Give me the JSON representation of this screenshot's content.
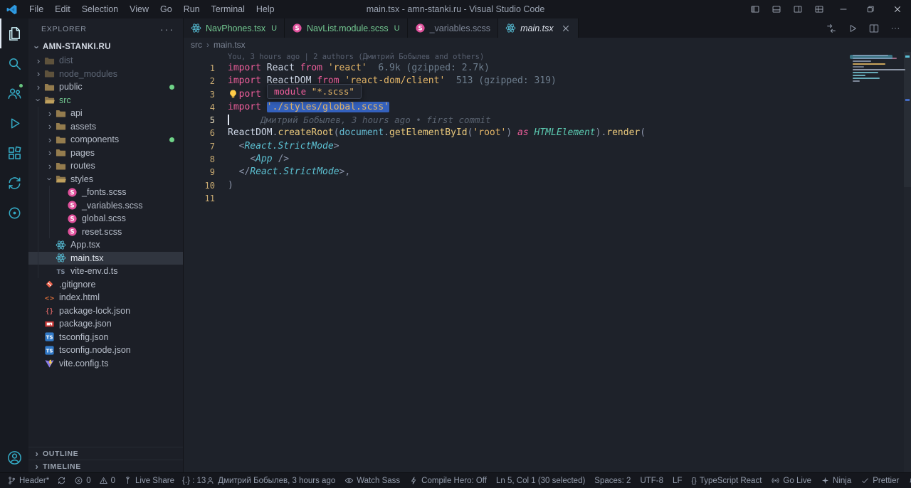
{
  "colors": {
    "accent_selection": "#3461bd",
    "untracked_green": "#73c991",
    "keyword_pink": "#ef5e9b",
    "string_gold": "#e6b768",
    "activity_teal": "#37b7d3"
  },
  "title_bar": {
    "menus": [
      "File",
      "Edit",
      "Selection",
      "View",
      "Go",
      "Run",
      "Terminal",
      "Help"
    ],
    "title": "main.tsx - amn-stanki.ru - Visual Studio Code",
    "window_controls": [
      {
        "name": "toggle-primary-sidebar",
        "icon": "panelL"
      },
      {
        "name": "toggle-panel",
        "icon": "panelB"
      },
      {
        "name": "toggle-secondary-sidebar",
        "icon": "panelR"
      },
      {
        "name": "customize-layout",
        "icon": "layoutC"
      },
      {
        "name": "minimize",
        "icon": "minim"
      },
      {
        "name": "restore",
        "icon": "restore"
      },
      {
        "name": "close",
        "icon": "closex"
      }
    ]
  },
  "activity_bar": {
    "top": [
      {
        "name": "explorer",
        "icon": "files",
        "active": true
      },
      {
        "name": "search",
        "icon": "search"
      },
      {
        "name": "accounts",
        "icon": "people",
        "badge": true
      },
      {
        "name": "run-debug",
        "icon": "run"
      },
      {
        "name": "extensions",
        "icon": "ext"
      },
      {
        "name": "remote-sync",
        "icon": "sync2"
      },
      {
        "name": "live-share",
        "icon": "circle"
      }
    ],
    "bottom": [
      {
        "name": "account",
        "icon": "account"
      }
    ]
  },
  "explorer": {
    "header": "EXPLORER",
    "root": "AMN-STANKI.RU",
    "sections": [
      "OUTLINE",
      "TIMELINE"
    ],
    "items": [
      {
        "label": "dist",
        "depth": 1,
        "icon": "folder",
        "chevron": "right",
        "dim": true
      },
      {
        "label": "node_modules",
        "depth": 1,
        "icon": "folder",
        "chevron": "right",
        "dim": true
      },
      {
        "label": "public",
        "depth": 1,
        "icon": "folder",
        "chevron": "right",
        "dot": true
      },
      {
        "label": "src",
        "depth": 1,
        "icon": "folderOpen",
        "chevron": "down",
        "git": "untracked"
      },
      {
        "label": "api",
        "depth": 2,
        "icon": "folder",
        "chevron": "right"
      },
      {
        "label": "assets",
        "depth": 2,
        "icon": "folder",
        "chevron": "right"
      },
      {
        "label": "components",
        "depth": 2,
        "icon": "folder",
        "chevron": "right",
        "dot": true
      },
      {
        "label": "pages",
        "depth": 2,
        "icon": "folder",
        "chevron": "right"
      },
      {
        "label": "routes",
        "depth": 2,
        "icon": "folder",
        "chevron": "right"
      },
      {
        "label": "styles",
        "depth": 2,
        "icon": "folderOpen",
        "chevron": "down"
      },
      {
        "label": "_fonts.scss",
        "depth": 3,
        "icon": "sass"
      },
      {
        "label": "_variables.scss",
        "depth": 3,
        "icon": "sass"
      },
      {
        "label": "global.scss",
        "depth": 3,
        "icon": "sass"
      },
      {
        "label": "reset.scss",
        "depth": 3,
        "icon": "sass"
      },
      {
        "label": "App.tsx",
        "depth": 2,
        "icon": "react"
      },
      {
        "label": "main.tsx",
        "depth": 2,
        "icon": "react",
        "selected": true
      },
      {
        "label": "vite-env.d.ts",
        "depth": 2,
        "icon": "tsfile"
      },
      {
        "label": ".gitignore",
        "depth": 1,
        "icon": "git"
      },
      {
        "label": "index.html",
        "depth": 1,
        "icon": "html"
      },
      {
        "label": "package-lock.json",
        "depth": 1,
        "icon": "jsonlock"
      },
      {
        "label": "package.json",
        "depth": 1,
        "icon": "npm"
      },
      {
        "label": "tsconfig.json",
        "depth": 1,
        "icon": "tsconfig"
      },
      {
        "label": "tsconfig.node.json",
        "depth": 1,
        "icon": "tsconfig"
      },
      {
        "label": "vite.config.ts",
        "depth": 1,
        "icon": "vite"
      }
    ]
  },
  "tabs": [
    {
      "label": "NavPhones.tsx",
      "icon": "react",
      "badge": "U",
      "git": "untracked"
    },
    {
      "label": "NavList.module.scss",
      "icon": "sass",
      "badge": "U",
      "git": "untracked"
    },
    {
      "label": "_variables.scss",
      "icon": "sass"
    },
    {
      "label": "main.tsx",
      "icon": "react",
      "active": true,
      "close": true
    }
  ],
  "editor_actions": [
    {
      "name": "open-changes",
      "icon": "compare"
    },
    {
      "name": "run-file",
      "icon": "play"
    },
    {
      "name": "split-editor",
      "icon": "split"
    },
    {
      "name": "more-actions",
      "icon": "more"
    }
  ],
  "breadcrumb": [
    "src",
    "main.tsx"
  ],
  "editor": {
    "codelens": "You, 3 hours ago | 2 authors (Дмитрий Бобылев and others)",
    "blame": "Дмитрий Бобылев, 3 hours ago • first commit",
    "tooltip": {
      "kw": "module ",
      "str": "\"*.scss\""
    },
    "lines": [
      [
        {
          "t": "import ",
          "c": "kw"
        },
        {
          "t": "React",
          "c": "var"
        },
        {
          "t": " from ",
          "c": "kw"
        },
        {
          "t": "'react'",
          "c": "str"
        },
        {
          "t": "  6.9k (gzipped: 2.7k)",
          "c": "cost"
        }
      ],
      [
        {
          "t": "import ",
          "c": "kw"
        },
        {
          "t": "ReactDOM",
          "c": "var"
        },
        {
          "t": " from ",
          "c": "kw"
        },
        {
          "t": "'react-dom/client'",
          "c": "str"
        },
        {
          "t": "  513 (gzipped: 319)",
          "c": "cost"
        }
      ],
      [
        {
          "t": "import ",
          "c": "kw"
        }
      ],
      [
        {
          "t": "import ",
          "c": "kw"
        },
        {
          "t": "'./styles/global.scss'",
          "c": "str sel"
        }
      ],
      [],
      [
        {
          "t": "ReactDOM",
          "c": "var"
        },
        {
          "t": ".",
          "c": "pun"
        },
        {
          "t": "createRoot",
          "c": "fn"
        },
        {
          "t": "(",
          "c": "pun"
        },
        {
          "t": "document",
          "c": "obj"
        },
        {
          "t": ".",
          "c": "pun"
        },
        {
          "t": "getElementById",
          "c": "fn"
        },
        {
          "t": "(",
          "c": "pun"
        },
        {
          "t": "'root'",
          "c": "str"
        },
        {
          "t": ")",
          "c": "pun"
        },
        {
          "t": " as ",
          "c": "kwit"
        },
        {
          "t": "HTMLElement",
          "c": "type"
        },
        {
          "t": ")",
          "c": "pun"
        },
        {
          "t": ".",
          "c": "pun"
        },
        {
          "t": "render",
          "c": "fn"
        },
        {
          "t": "(",
          "c": "pun"
        }
      ],
      [
        {
          "t": "  ",
          "c": "pun"
        },
        {
          "t": "<",
          "c": "pun"
        },
        {
          "t": "React.StrictMode",
          "c": "jsx"
        },
        {
          "t": ">",
          "c": "pun"
        }
      ],
      [
        {
          "t": "    ",
          "c": "pun"
        },
        {
          "t": "<",
          "c": "pun"
        },
        {
          "t": "App",
          "c": "jsx"
        },
        {
          "t": " />",
          "c": "pun"
        }
      ],
      [
        {
          "t": "  ",
          "c": "pun"
        },
        {
          "t": "</",
          "c": "pun"
        },
        {
          "t": "React.StrictMode",
          "c": "jsx"
        },
        {
          "t": ">,",
          "c": "pun"
        }
      ],
      [
        {
          "t": ")",
          "c": "pun"
        }
      ],
      []
    ]
  },
  "status_bar": {
    "left": [
      {
        "icon": "branch",
        "label": "Header*",
        "name": "git-branch"
      },
      {
        "icon": "sync",
        "label": "",
        "name": "sync-changes"
      },
      {
        "icon": "error",
        "label": "0",
        "name": "errors"
      },
      {
        "icon": "warning",
        "label": "0",
        "name": "warnings"
      },
      {
        "icon": "liveshare",
        "label": "Live Share",
        "name": "live-share"
      },
      {
        "icon": "",
        "label": "{.} : 13",
        "name": "bracket-count"
      }
    ],
    "right": [
      {
        "icon": "person",
        "label": "Дмитрий Бобылев, 3 hours ago",
        "name": "git-blame"
      },
      {
        "icon": "eye",
        "label": "Watch Sass",
        "name": "watch-sass"
      },
      {
        "icon": "zap",
        "label": "Compile Hero: Off",
        "name": "compile-hero"
      },
      {
        "icon": "",
        "label": "Ln 5, Col 1 (30 selected)",
        "name": "cursor-position"
      },
      {
        "icon": "",
        "label": "Spaces: 2",
        "name": "indentation"
      },
      {
        "icon": "",
        "label": "UTF-8",
        "name": "encoding"
      },
      {
        "icon": "",
        "label": "LF",
        "name": "eol"
      },
      {
        "icon": "braces",
        "label": "TypeScript React",
        "name": "language-mode"
      },
      {
        "icon": "broadcast",
        "label": "Go Live",
        "name": "go-live"
      },
      {
        "icon": "ninja",
        "label": "Ninja",
        "name": "ninja"
      },
      {
        "icon": "check",
        "label": "Prettier",
        "name": "prettier"
      },
      {
        "icon": "bell",
        "label": "",
        "name": "notifications"
      }
    ]
  }
}
